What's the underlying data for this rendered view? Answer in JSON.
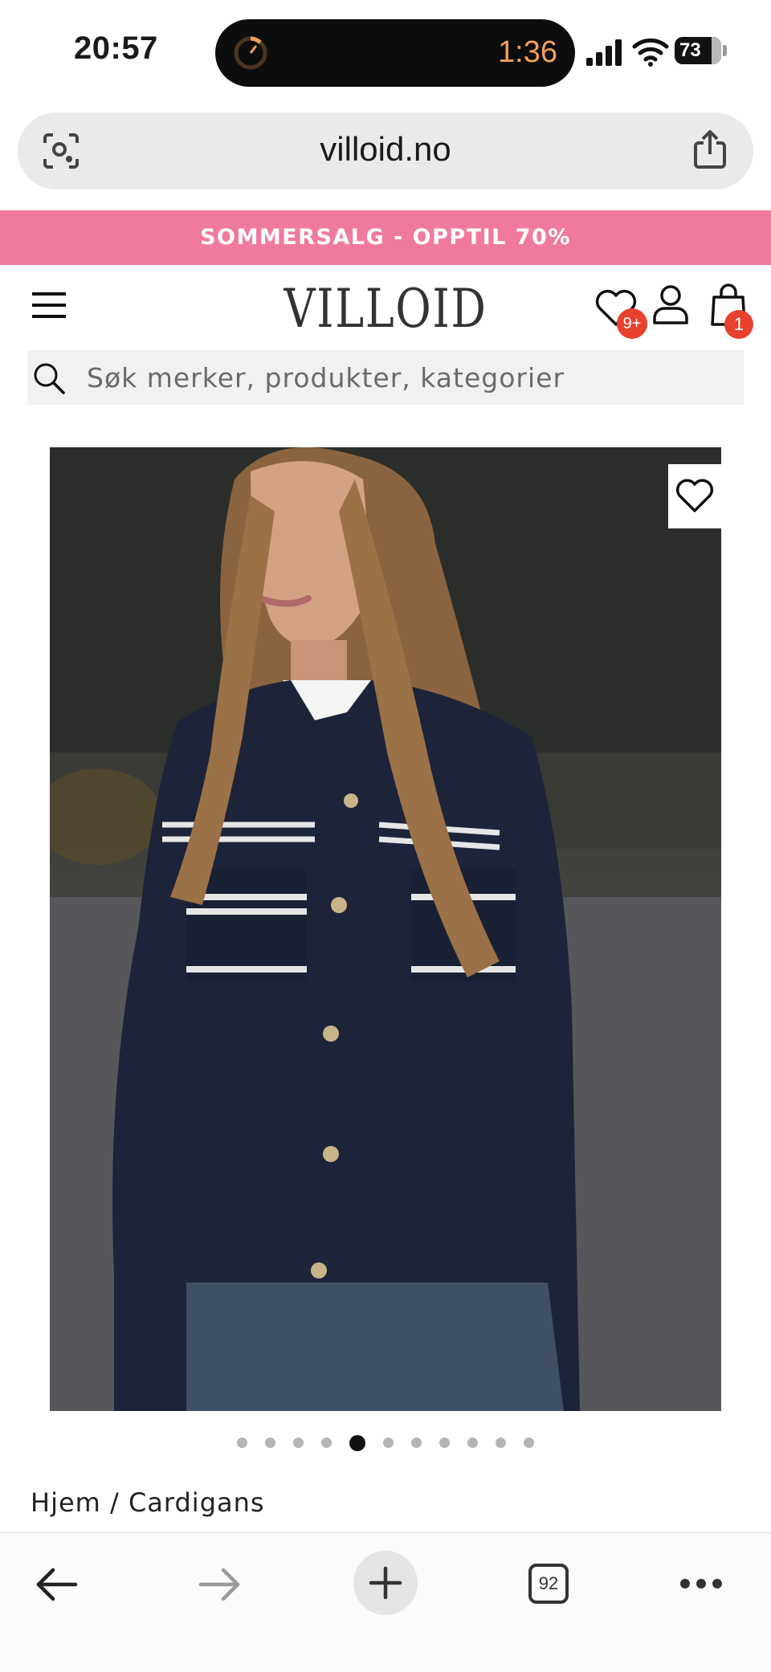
{
  "status_bar": {
    "time": "20:57",
    "timer": "1:36",
    "battery": "73",
    "icons": [
      "timer-icon",
      "signal-icon",
      "wifi-icon",
      "battery-icon"
    ]
  },
  "browser": {
    "url": "villoid.no",
    "tab_count": "92",
    "icons": [
      "lens-icon",
      "share-icon",
      "back-icon",
      "forward-icon",
      "new-tab-icon",
      "more-icon"
    ]
  },
  "promo": {
    "text": "SOMMERSALG - OPPTIL 70%",
    "color": "#f07a9e"
  },
  "header": {
    "logo": "VILLOID",
    "wishlist_badge": "9+",
    "cart_badge": "1",
    "badge_color": "#e8422e",
    "icons": [
      "menu-icon",
      "heart-icon",
      "account-icon",
      "bag-icon"
    ]
  },
  "search": {
    "placeholder": "Søk merker, produkter, kategorier",
    "value": ""
  },
  "product": {
    "image_alt": "Navy knit cardigan",
    "slides_total": 11,
    "slide_active": 5
  },
  "breadcrumb": {
    "home": "Hjem",
    "separator": " / ",
    "category": "Cardigans"
  }
}
